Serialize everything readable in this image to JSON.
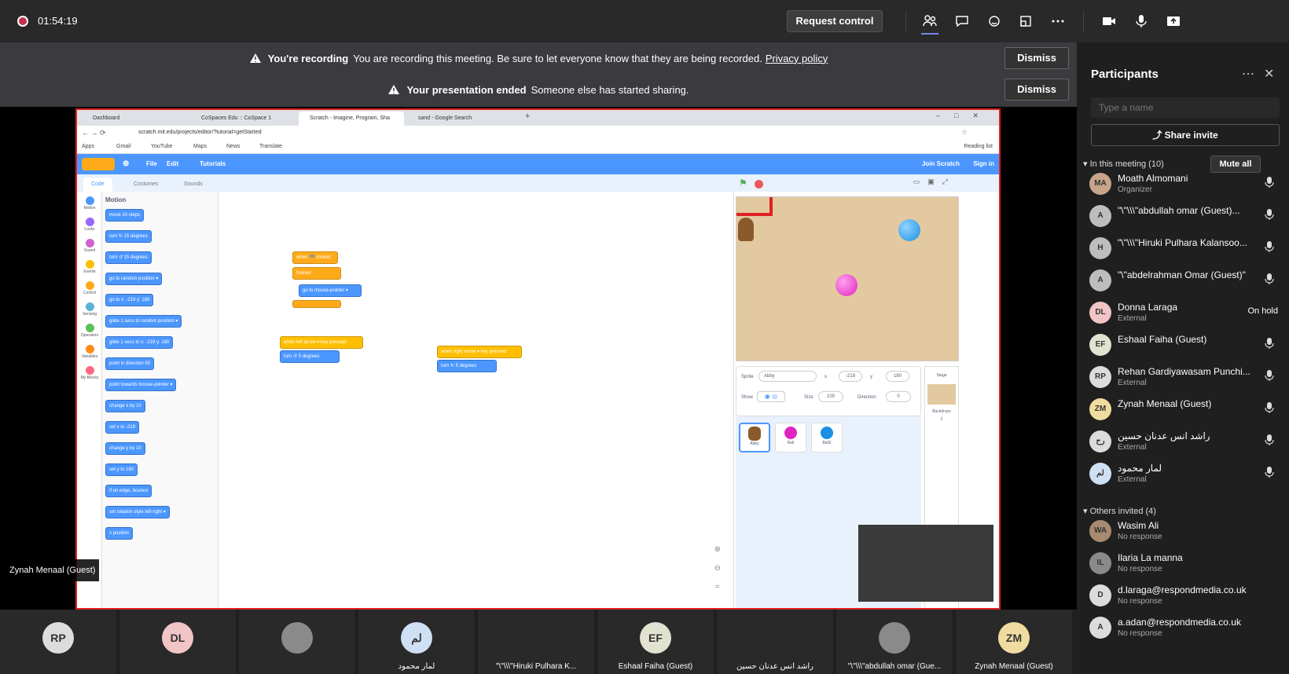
{
  "topbar": {
    "timer": "01:54:19",
    "request_control": "Request control"
  },
  "banners": [
    {
      "bold": "You're recording",
      "text": "You are recording this meeting. Be sure to let everyone know that they are being recorded.",
      "link": "Privacy policy",
      "dismiss": "Dismiss"
    },
    {
      "bold": "Your presentation ended",
      "text": "Someone else has started sharing.",
      "link": "",
      "dismiss": "Dismiss"
    }
  ],
  "browser": {
    "tabs": [
      "Dashboard",
      "CoSpaces Edu :: CoSpace 1",
      "Scratch - Imagine, Program, Sha",
      "sand - Google Search"
    ],
    "url": "scratch.mit.edu/projects/editor/?tutorial=getStarted",
    "bookmarks": [
      "Apps",
      "Gmail",
      "YouTube",
      "Maps",
      "News",
      "Translate"
    ],
    "reading_list": "Reading list"
  },
  "scratch": {
    "menu": [
      "File",
      "Edit",
      "Tutorials"
    ],
    "join": "Join Scratch",
    "signin": "Sign in",
    "tabs": [
      "Code",
      "Costumes",
      "Sounds"
    ],
    "categories": [
      "Motion",
      "Looks",
      "Sound",
      "Events",
      "Control",
      "Sensing",
      "Operators",
      "Variables",
      "My Blocks"
    ],
    "category_colors": [
      "#4c97ff",
      "#9966ff",
      "#cf63cf",
      "#ffbf00",
      "#ffab19",
      "#5cb1d6",
      "#59c059",
      "#ff8c1a",
      "#ff6680"
    ],
    "palette_title": "Motion",
    "palette_blocks": [
      "move 10 steps",
      "turn ↻ 15 degrees",
      "turn ↺ 15 degrees",
      "go to random position ▾",
      "go to x: -219 y: 180",
      "glide 1 secs to random position ▾",
      "glide 1 secs to x: -219 y: 180",
      "point in direction 90",
      "point towards mouse-pointer ▾",
      "change x by 10",
      "set x to -219",
      "change y by 10",
      "set y to 180",
      "if on edge, bounce",
      "set rotation style left-right ▾",
      "x position"
    ],
    "script_blocks": [
      "when 🏁 clicked",
      "forever",
      "go to mouse-pointer ▾",
      "when left arrow ▾ key pressed",
      "turn ↺ 5 degrees",
      "when right arrow ▾ key pressed",
      "turn ↻ 5 degrees"
    ],
    "sprite_info": {
      "sprite_label": "Sprite",
      "sprite_name": "Abby",
      "x_label": "x",
      "x": "-219",
      "y_label": "y",
      "y": "180",
      "show_label": "Show",
      "size_label": "Size",
      "size": "100",
      "direction_label": "Direction",
      "direction": "0"
    },
    "sprites": [
      "Abby",
      "Ball",
      "Ball2"
    ],
    "stage_panel": {
      "label": "Stage",
      "backdrops_label": "Backdrops",
      "backdrops": "2"
    }
  },
  "presenter_label": "Zynah Menaal (Guest)",
  "panel": {
    "title": "Participants",
    "search_placeholder": "Type a name",
    "share_invite": "Share invite",
    "in_meeting": "In this meeting (10)",
    "mute_all": "Mute all",
    "others_invited": "Others invited (4)",
    "members": [
      {
        "initials": "MA",
        "name": "Moath Almomani",
        "sub": "Organizer",
        "status": "",
        "avatar_color": "#c8a48a"
      },
      {
        "initials": "A",
        "name": "\"\\\"\\\\\\\"abdullah omar (Guest)...",
        "sub": "",
        "status": "",
        "avatar_color": "#bdbdbd"
      },
      {
        "initials": "H",
        "name": "\"\\\"\\\\\\\"Hiruki Pulhara Kalansoo...",
        "sub": "",
        "status": "",
        "avatar_color": "#bdbdbd"
      },
      {
        "initials": "A",
        "name": "\"\\\"abdelrahman Omar (Guest)\"",
        "sub": "",
        "status": "",
        "avatar_color": "#bdbdbd"
      },
      {
        "initials": "DL",
        "name": "Donna Laraga",
        "sub": "External",
        "status": "On hold",
        "avatar_color": "#f1c4c6"
      },
      {
        "initials": "EF",
        "name": "Eshaal Faiha (Guest)",
        "sub": "",
        "status": "",
        "avatar_color": "#e2e2d0"
      },
      {
        "initials": "RP",
        "name": "Rehan Gardiyawasam Punchi...",
        "sub": "External",
        "status": "",
        "avatar_color": "#dcdcdc"
      },
      {
        "initials": "ZM",
        "name": "Zynah Menaal (Guest)",
        "sub": "",
        "status": "",
        "avatar_color": "#f0dca0"
      },
      {
        "initials": "رح",
        "name": "راشد انس عدنان حسين",
        "sub": "External",
        "status": "",
        "avatar_color": "#dcdcdc"
      },
      {
        "initials": "لم",
        "name": "لمار محمود",
        "sub": "External",
        "status": "",
        "avatar_color": "#cfe0f5"
      }
    ],
    "invited": [
      {
        "initials": "WA",
        "name": "Wasim Ali",
        "sub": "No response",
        "avatar_color": "#a88a70"
      },
      {
        "initials": "IL",
        "name": "Ilaria La manna",
        "sub": "No response",
        "avatar_color": "#8a8a8a"
      },
      {
        "initials": "D",
        "name": "d.laraga@respondmedia.co.uk",
        "sub": "No response",
        "avatar_color": "#dcdcdc"
      },
      {
        "initials": "A",
        "name": "a.adan@respondmedia.co.uk",
        "sub": "No response",
        "avatar_color": "#dcdcdc"
      }
    ]
  },
  "bottom_tiles": [
    {
      "initials": "RP",
      "label": "",
      "color": "#dcdcdc"
    },
    {
      "initials": "DL",
      "label": "",
      "color": "#f1c4c6"
    },
    {
      "initials": "",
      "label": "",
      "color": "#8a8a8a"
    },
    {
      "initials": "لم",
      "label": "لمار محمود",
      "color": "#cfe0f5"
    },
    {
      "initials": "",
      "label": "\"\\\"\\\\\\\"Hiruki Pulhara K...",
      "color": ""
    },
    {
      "initials": "EF",
      "label": "Eshaal Faiha (Guest)",
      "color": "#e2e2d0"
    },
    {
      "initials": "",
      "label": "راشد انس عدنان حسين",
      "color": ""
    },
    {
      "initials": "",
      "label": "\"\\\"\\\\\\\"abdullah omar (Gue...",
      "color": "#8a8a8a"
    },
    {
      "initials": "ZM",
      "label": "Zynah Menaal (Guest)",
      "color": "#f0dca0"
    }
  ]
}
